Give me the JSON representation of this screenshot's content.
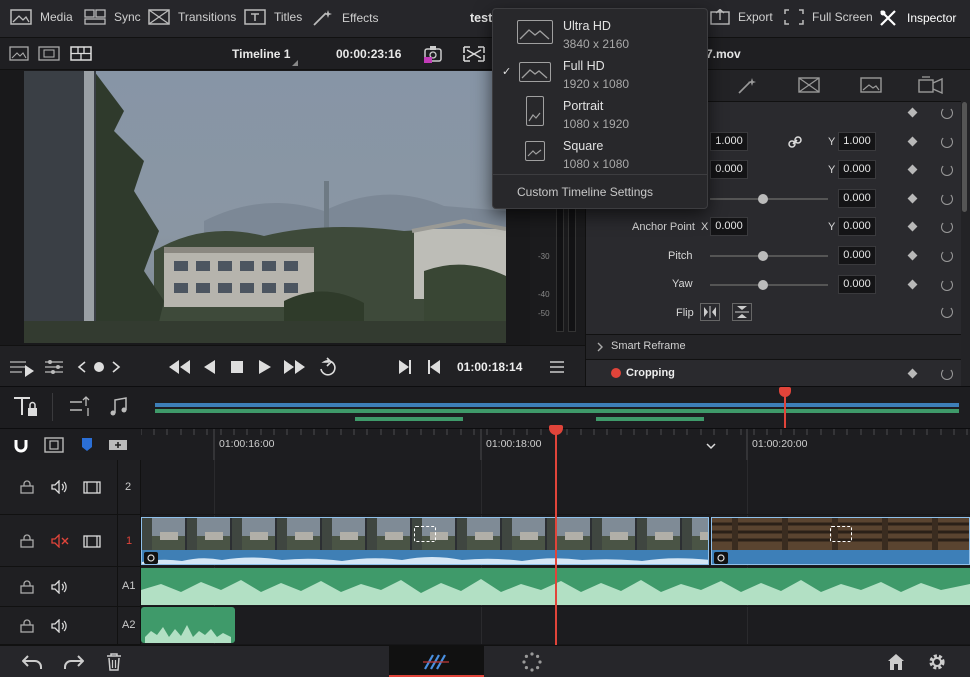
{
  "topbar": {
    "menu": [
      {
        "label": "Media",
        "icon": "media-icon"
      },
      {
        "label": "Sync",
        "icon": "sync-icon"
      },
      {
        "label": "Transitions",
        "icon": "transitions-icon"
      },
      {
        "label": "Titles",
        "icon": "titles-icon"
      },
      {
        "label": "Effects",
        "icon": "effects-icon"
      }
    ],
    "project_title": "test",
    "right_menu": [
      {
        "label": "Export",
        "icon": "export-icon"
      },
      {
        "label": "Full Screen",
        "icon": "fullscreen-icon"
      },
      {
        "label": "Inspector",
        "icon": "inspector-icon"
      }
    ]
  },
  "viewer": {
    "timeline_name": "Timeline 1",
    "duration": "00:00:23:16",
    "clip_name": "7.mov",
    "timecode": "01:00:18:14",
    "meter_labels": [
      "-30",
      "-40",
      "-50"
    ]
  },
  "resolution_menu": {
    "items": [
      {
        "name": "Ultra HD",
        "resolution": "3840 x 2160",
        "selected": false
      },
      {
        "name": "Full HD",
        "resolution": "1920 x 1080",
        "selected": true
      },
      {
        "name": "Portrait",
        "resolution": "1080 x 1920",
        "selected": false
      },
      {
        "name": "Square",
        "resolution": "1080 x 1080",
        "selected": false
      }
    ],
    "custom_label": "Custom Timeline Settings",
    "check_mark": "✓"
  },
  "inspector": {
    "zoom_x": "1.000",
    "zoom_y": "1.000",
    "position_x": "0.000",
    "position_y": "0.000",
    "rotation": "0.000",
    "anchor_label": "Anchor Point",
    "anchor_x": "0.000",
    "anchor_y": "0.000",
    "pitch_label": "Pitch",
    "pitch": "0.000",
    "yaw_label": "Yaw",
    "yaw": "0.000",
    "flip_label": "Flip",
    "x_label": "X",
    "y_label": "Y",
    "smart_reframe_label": "Smart Reframe",
    "cropping_label": "Cropping"
  },
  "timeline": {
    "ruler_marks": [
      "01:00:16:00",
      "01:00:18:00",
      "01:00:20:00"
    ],
    "tracks": [
      {
        "label": "2"
      },
      {
        "label": "1"
      },
      {
        "label": "A1"
      },
      {
        "label": "A2"
      }
    ]
  },
  "colors": {
    "playhead": "#e0443a",
    "video_clip": "#3d7fb8",
    "audio_clip": "#3f9a6a",
    "accent_red": "#e0443a"
  }
}
